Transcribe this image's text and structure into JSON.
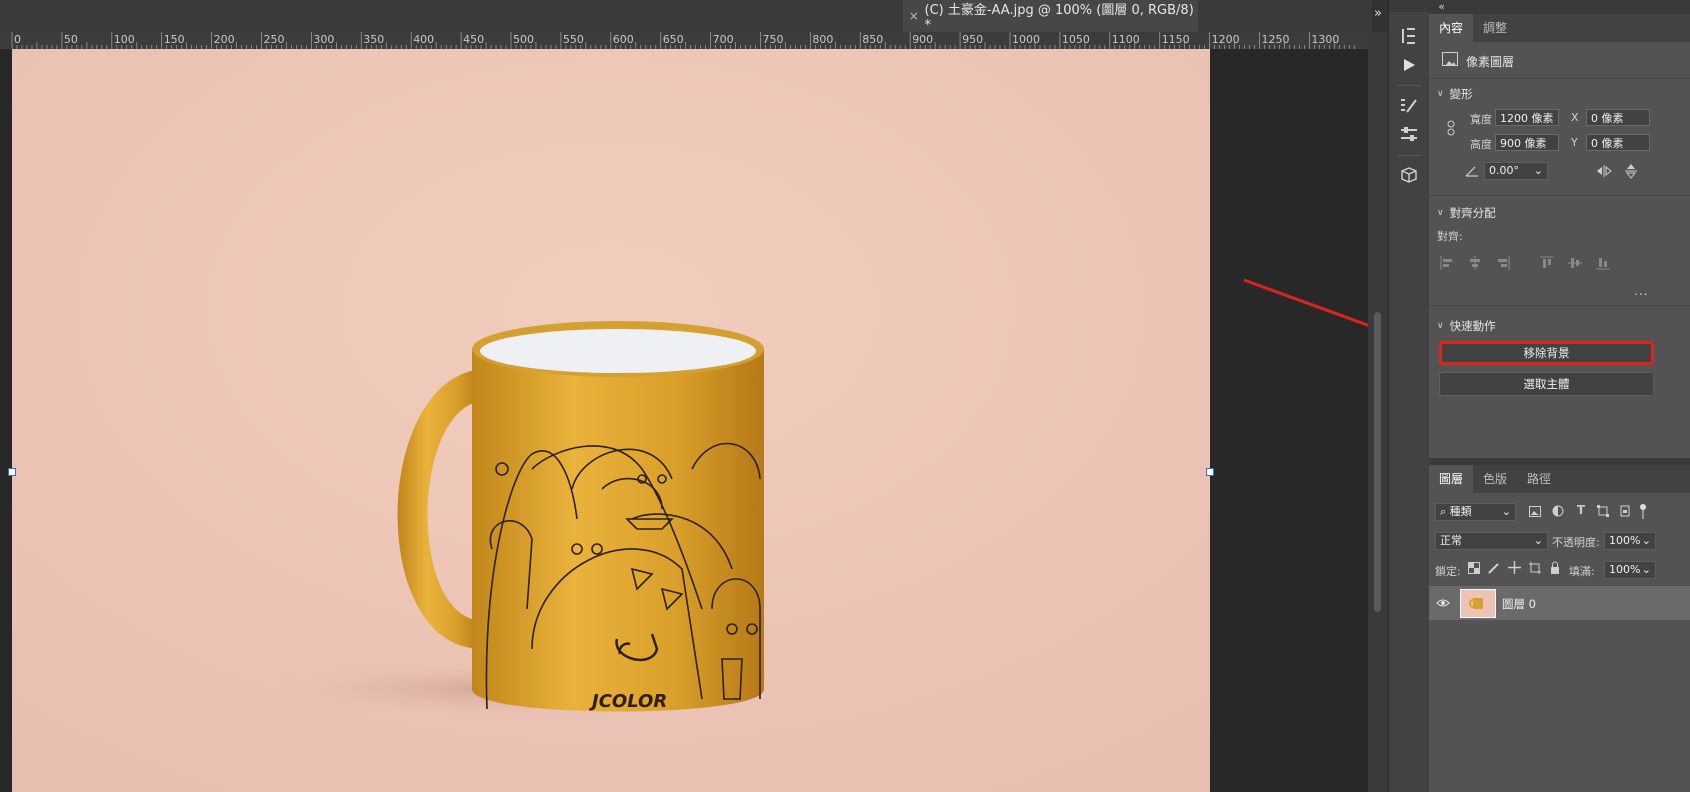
{
  "document_tab": {
    "close": "×",
    "title": "(C) 土豪金-AA.jpg @ 100% (圖層 0, RGB/8) *"
  },
  "ruler": {
    "labels": [
      "0",
      "50",
      "100",
      "150",
      "200",
      "250",
      "300",
      "350",
      "400",
      "450",
      "500",
      "550",
      "600",
      "650",
      "700",
      "750",
      "800",
      "850",
      "900",
      "950",
      "1000",
      "1050",
      "1100",
      "1150",
      "1200",
      "1250",
      "1300"
    ]
  },
  "annotation": {
    "arrow_color": "#d9261c",
    "highlight_color": "#d9261c"
  },
  "mug_logo": "JCOLOR",
  "tools": [
    "history-icon",
    "play-icon",
    "brush-presets-icon",
    "adjust-sliders-icon",
    "3d-cube-icon"
  ],
  "panel": {
    "collapse": "«",
    "expand": "»",
    "top_tabs": [
      "內容",
      "調整"
    ],
    "layer_kind": "像素圖層",
    "transform": {
      "title": "變形",
      "width_label": "寬度",
      "width_value": "1200 像素",
      "height_label": "高度",
      "height_value": "900 像素",
      "x_label": "X",
      "x_value": "0 像素",
      "y_label": "Y",
      "y_value": "0 像素",
      "angle_value": "0.00°"
    },
    "align": {
      "title": "對齊分配",
      "label": "對齊:",
      "more": "..."
    },
    "quick_actions": {
      "title": "快速動作",
      "remove_bg": "移除背景",
      "select_subject": "選取主體"
    },
    "layers": {
      "tabs": [
        "圖層",
        "色版",
        "路徑"
      ],
      "filter_kind": "種類",
      "blend_mode": "正常",
      "opacity_label": "不透明度:",
      "opacity_value": "100%",
      "lock_label": "鎖定:",
      "fill_label": "填滿:",
      "fill_value": "100%",
      "layer_name": "圖層 0"
    }
  }
}
